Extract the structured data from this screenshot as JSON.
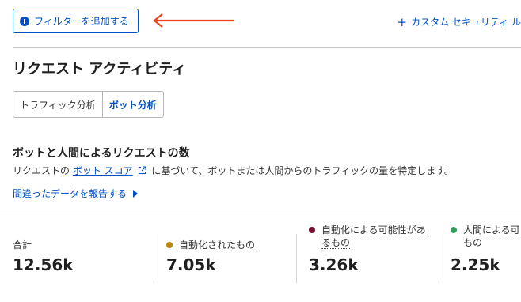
{
  "toolbar": {
    "add_filter_label": "フィルターを追加する",
    "custom_security_label": "カスタム セキュリティ ル"
  },
  "page": {
    "title": "リクエスト アクティビティ"
  },
  "tabs": [
    {
      "label": "トラフィック分析",
      "active": false
    },
    {
      "label": "ボット分析",
      "active": true
    }
  ],
  "section": {
    "title": "ボットと人間によるリクエストの数",
    "desc_prefix": "リクエストの",
    "desc_link": "ボット スコア",
    "desc_suffix": "に基づいて、ボットまたは人間からのトラフィックの量を特定します。",
    "report_link": "間違ったデータを報告する"
  },
  "metrics": [
    {
      "label": "合計",
      "value": "12.56k"
    },
    {
      "label": "自動化されたもの",
      "value": "7.05k",
      "color": "#b8860b"
    },
    {
      "label_line1": "自動化による可能性があ",
      "label_line2": "るもの",
      "value": "3.26k",
      "color": "#7a0c2e"
    },
    {
      "label_line1": "人間による可",
      "label_line2": "もの",
      "value": "2.25k",
      "color": "#2e9e5b"
    }
  ],
  "colors": {
    "accent": "#0051c3",
    "annotation_arrow": "#e8431f"
  }
}
